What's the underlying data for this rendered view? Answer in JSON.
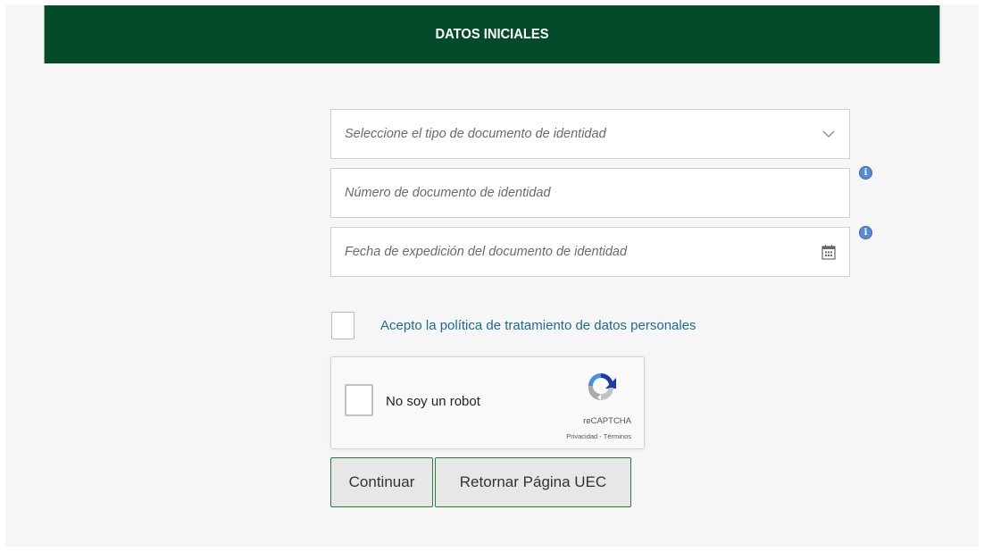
{
  "header": {
    "title": "DATOS INICIALES"
  },
  "form": {
    "doc_type_placeholder": "Seleccione el tipo de documento de identidad",
    "doc_number_placeholder": "Número de documento de identidad",
    "doc_date_placeholder": "Fecha de expedición del documento de identidad",
    "policy_label": "Acepto la política de tratamiento de datos personales",
    "info_glyph": "i"
  },
  "captcha": {
    "label": "No soy un robot",
    "brand": "reCAPTCHA",
    "links": "Privacidad - Términos"
  },
  "buttons": {
    "continue_label": "Continuar",
    "return_label": "Retornar Página UEC"
  },
  "colors": {
    "header_bg": "#034b2a",
    "link": "#1e6a90",
    "info_icon": "#5a8bd0",
    "button_border": "#2a7a3a"
  },
  "icons": {
    "select_arrow": "chevron-down-icon",
    "date_picker": "calendar-icon",
    "info": "info-icon",
    "captcha_logo": "recaptcha-logo-icon"
  }
}
